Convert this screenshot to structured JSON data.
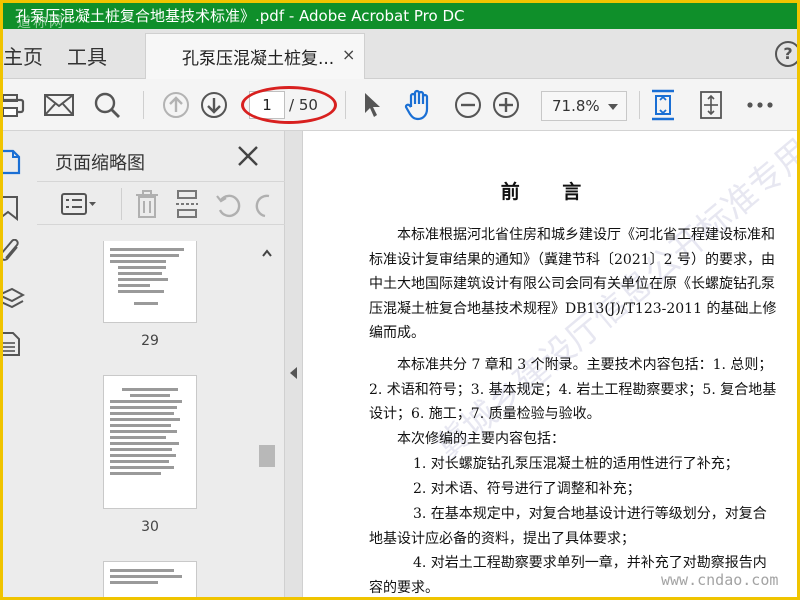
{
  "window": {
    "title": "孔泵压混凝土桩复合地基技术标准》.pdf - Adobe Acrobat Pro DC",
    "watermark": "道称网"
  },
  "tabs": {
    "home": "主页",
    "tools": "工具",
    "document": "孔泵压混凝土桩复...",
    "close": "×"
  },
  "toolbar": {
    "current_page": "1",
    "page_total": "/ 50",
    "zoom": "71.8%"
  },
  "thumbnails": {
    "title": "页面缩略图",
    "pages": [
      {
        "number": "29"
      },
      {
        "number": "30"
      }
    ]
  },
  "document": {
    "heading": "前 言",
    "paragraphs": [
      "本标准根据河北省住房和城乡建设厅《河北省工程建设标准和标准设计复审结果的通知》（冀建节科〔2021〕2 号）的要求，由中土大地国际建筑设计有限公司会同有关单位在原《长螺旋钻孔泵压混凝土桩复合地基技术规程》DB13(J)/T123-2011 的基础上修编而成。",
      "本标准共分 7 章和 3 个附录。主要技术内容包括：1. 总则；2. 术语和符号；3. 基本规定；4. 岩土工程勘察要求；5. 复合地基设计；6. 施工；7. 质量检验与验收。",
      "本次修编的主要内容包括：",
      "1. 对长螺旋钻孔泵压混凝土桩的适用性进行了补充；",
      "2. 对术语、符号进行了调整和补充；",
      "3. 在基本规定中，对复合地基设计进行等级划分，对复合地基设计应必备的资料，提出了具体要求；",
      "4. 对岩土工程勘察要求单列一章，并补充了对勘察报告内容的要求。"
    ],
    "watermark_diagonal": "冀城乡建设厅信息公开标准专用",
    "watermark_site": "www.cndao.com"
  },
  "colors": {
    "titlebar": "#0f8f2a",
    "frame": "#f0c400",
    "accent_blue": "#1a6fd4",
    "highlight": "#d8201f"
  }
}
